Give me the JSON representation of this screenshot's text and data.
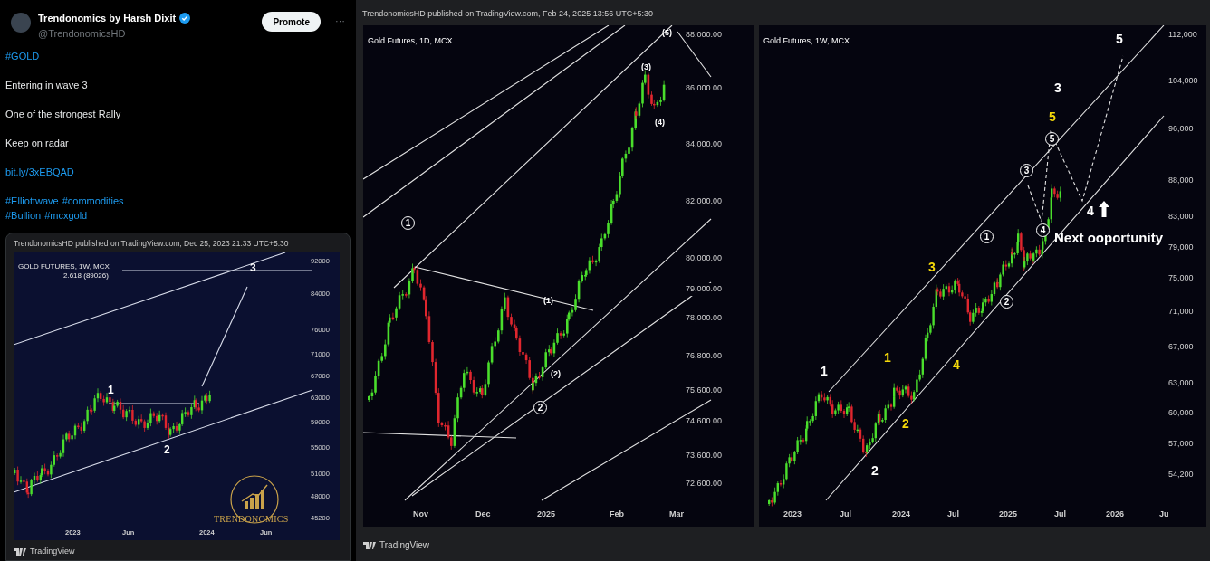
{
  "post": {
    "author": "Trendonomics by Harsh Dixit",
    "verified": true,
    "handle": "@TrendonomicsHD",
    "promote_button": "Promote",
    "more_button": "···",
    "body": [
      {
        "kind": "links",
        "lines": [
          [
            "#GOLD"
          ]
        ]
      },
      {
        "kind": "text",
        "text": "Entering in wave 3"
      },
      {
        "kind": "text",
        "text": "One of the strongest Rally"
      },
      {
        "kind": "text",
        "text": "Keep on radar"
      },
      {
        "kind": "links",
        "lines": [
          [
            "bit.ly/3xEBQAD"
          ]
        ]
      },
      {
        "kind": "links",
        "lines": [
          [
            "#Elliottwave",
            "#commodities"
          ],
          [
            "#Bullion",
            "#mcxgold"
          ]
        ]
      }
    ],
    "embedded_chart": {
      "publisher": "TrendonomicsHD published on TradingView.com, Dec 25, 2023 21:33 UTC+5:30",
      "title": "GOLD FUTURES, 1W, MCX",
      "fib_level": "2.618 (89026)",
      "y_labels": [
        "92000",
        "84000",
        "76000",
        "71000",
        "67000",
        "63000",
        "59000",
        "55000",
        "51000",
        "48000",
        "45200"
      ],
      "x_labels": [
        "2023",
        "Jun",
        "2024",
        "Jun"
      ],
      "wave_labels": [
        {
          "text": "1",
          "kind": "plain",
          "color": "#ffffff"
        },
        {
          "text": "2",
          "kind": "plain",
          "color": "#ffffff"
        },
        {
          "text": "3",
          "kind": "plain",
          "color": "#ffffff"
        }
      ],
      "logo_text": "TRENDONOMICS",
      "footer": "TradingView"
    }
  },
  "publication": {
    "publisher": "TrendonomicsHD published on TradingView.com, Feb 24, 2025 13:56 UTC+5:30",
    "footer": "TradingView",
    "daily_chart": {
      "title": "Gold Futures, 1D, MCX",
      "y_labels": [
        "88,000.00",
        "86,000.00",
        "84,000.00",
        "82,000.00",
        "80,000.00",
        "79,000.00",
        "78,000.00",
        "76,800.00",
        "75,600.00",
        "74,600.00",
        "73,600.00",
        "72,600.00"
      ],
      "x_labels": [
        "Nov",
        "Dec",
        "2025",
        "Feb",
        "Mar"
      ],
      "wave_labels": [
        {
          "text": "1",
          "kind": "circled",
          "color": "#ffffff"
        },
        {
          "text": "(1)",
          "kind": "plain",
          "color": "#ffffff"
        },
        {
          "text": "(2)",
          "kind": "plain",
          "color": "#ffffff"
        },
        {
          "text": "2",
          "kind": "circled",
          "color": "#ffffff"
        },
        {
          "text": "(3)",
          "kind": "plain",
          "color": "#ffffff"
        },
        {
          "text": "(4)",
          "kind": "plain",
          "color": "#ffffff"
        },
        {
          "text": "(5)",
          "kind": "plain",
          "color": "#ffffff"
        }
      ]
    },
    "weekly_chart": {
      "title": "Gold Futures, 1W, MCX",
      "y_labels": [
        "112,000",
        "104,000",
        "96,000",
        "88,000",
        "83,000",
        "79,000",
        "75,000",
        "71,000",
        "67,000",
        "63,000",
        "60,000",
        "57,000",
        "54,200"
      ],
      "x_labels": [
        "2023",
        "Jul",
        "2024",
        "Jul",
        "2025",
        "Jul",
        "2026",
        "Ju"
      ],
      "wave_labels": [
        {
          "text": "1",
          "kind": "plain",
          "color": "#ffffff"
        },
        {
          "text": "2",
          "kind": "plain",
          "color": "#ffffff"
        },
        {
          "text": "1",
          "kind": "plain",
          "color": "#f5d90a"
        },
        {
          "text": "2",
          "kind": "plain",
          "color": "#f5d90a"
        },
        {
          "text": "3",
          "kind": "plain",
          "color": "#f5d90a"
        },
        {
          "text": "4",
          "kind": "plain",
          "color": "#f5d90a"
        },
        {
          "text": "1",
          "kind": "circled",
          "color": "#ffffff"
        },
        {
          "text": "2",
          "kind": "circled",
          "color": "#ffffff"
        },
        {
          "text": "3",
          "kind": "circled",
          "color": "#ffffff"
        },
        {
          "text": "4",
          "kind": "circled",
          "color": "#ffffff"
        },
        {
          "text": "5",
          "kind": "circled",
          "color": "#ffffff"
        },
        {
          "text": "5",
          "kind": "plain",
          "color": "#f5d90a"
        },
        {
          "text": "3",
          "kind": "plain",
          "color": "#ffffff"
        },
        {
          "text": "5",
          "kind": "plain",
          "color": "#ffffff"
        },
        {
          "text": "4",
          "kind": "plain",
          "color": "#ffffff"
        }
      ],
      "note": "Next ooportunity"
    }
  }
}
